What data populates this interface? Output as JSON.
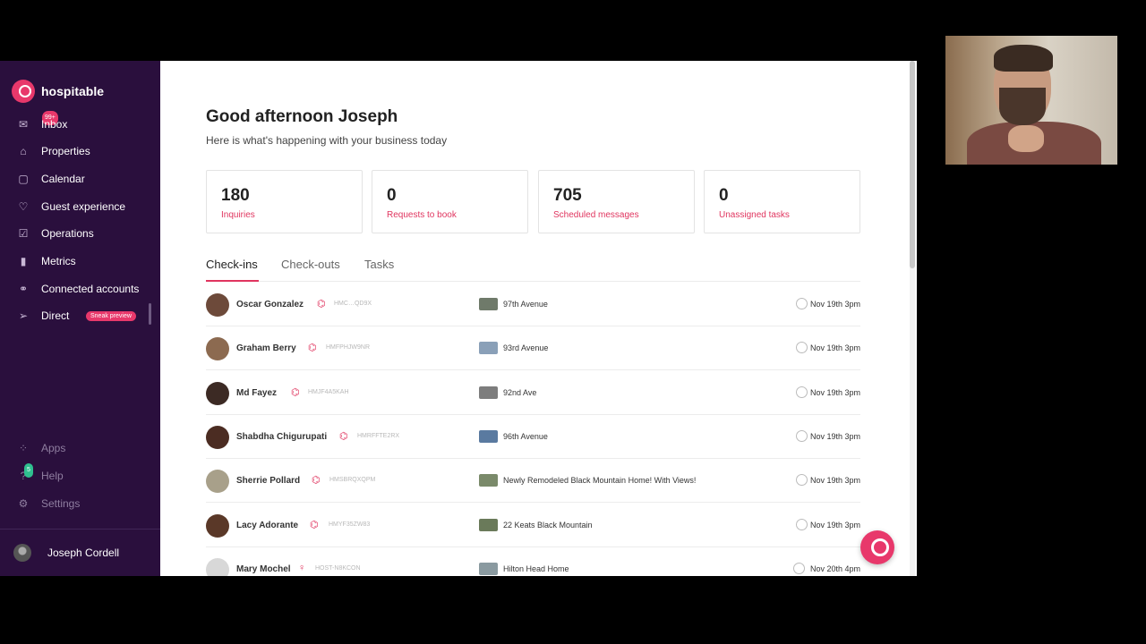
{
  "app": {
    "name": "hospitable"
  },
  "sidebar": {
    "items": [
      {
        "label": "Inbox",
        "icon": "mail-icon",
        "badge": "99+"
      },
      {
        "label": "Properties",
        "icon": "home-icon"
      },
      {
        "label": "Calendar",
        "icon": "calendar-icon"
      },
      {
        "label": "Guest experience",
        "icon": "heart-icon"
      },
      {
        "label": "Operations",
        "icon": "checkbox-icon"
      },
      {
        "label": "Metrics",
        "icon": "bar-chart-icon"
      },
      {
        "label": "Connected accounts",
        "icon": "link-icon"
      },
      {
        "label": "Direct",
        "icon": "send-icon",
        "tag": "Sneak preview"
      }
    ],
    "bottom_items": [
      {
        "label": "Apps",
        "icon": "apps-icon"
      },
      {
        "label": "Help",
        "icon": "help-icon",
        "badge": "5"
      },
      {
        "label": "Settings",
        "icon": "gear-icon"
      }
    ],
    "user": {
      "name": "Joseph Cordell"
    }
  },
  "main": {
    "greeting": "Good afternoon Joseph",
    "subtitle": "Here is what's happening with your business today",
    "stats": [
      {
        "value": "180",
        "label": "Inquiries"
      },
      {
        "value": "0",
        "label": "Requests to book"
      },
      {
        "value": "705",
        "label": "Scheduled messages"
      },
      {
        "value": "0",
        "label": "Unassigned tasks"
      }
    ],
    "tabs": [
      {
        "label": "Check-ins",
        "active": true
      },
      {
        "label": "Check-outs",
        "active": false
      },
      {
        "label": "Tasks",
        "active": false
      }
    ],
    "checkins": [
      {
        "guest": "Oscar Gonzalez",
        "channel": "airbnb-icon",
        "code": "HMC…QD9X",
        "property": "97th Avenue",
        "date": "Nov 19th 3pm"
      },
      {
        "guest": "Graham Berry",
        "channel": "airbnb-icon",
        "code": "HMFPHJW9NR",
        "property": "93rd Avenue",
        "date": "Nov 19th 3pm"
      },
      {
        "guest": "Md Fayez",
        "channel": "airbnb-icon",
        "code": "HMJF4A5KAH",
        "property": "92nd Ave",
        "date": "Nov 19th 3pm"
      },
      {
        "guest": "Shabdha Chigurupati",
        "channel": "airbnb-icon",
        "code": "HMRFFTE2RX",
        "property": "96th Avenue",
        "date": "Nov 19th 3pm"
      },
      {
        "guest": "Sherrie Pollard",
        "channel": "airbnb-icon",
        "code": "HMSBRQXQPM",
        "property": "Newly Remodeled Black Mountain Home! With Views!",
        "date": "Nov 19th 3pm"
      },
      {
        "guest": "Lacy Adorante",
        "channel": "airbnb-icon",
        "code": "HMYF35ZW83",
        "property": "22 Keats Black Mountain",
        "date": "Nov 19th 3pm"
      },
      {
        "guest": "Mary Mochel",
        "channel": "hospitable-icon",
        "code": "HOST-N8KCON",
        "property": "Hilton Head Home",
        "date": "Nov 20th 4pm"
      }
    ]
  },
  "colors": {
    "accent": "#e0355f",
    "sidebar_bg": "#2a0f3d"
  }
}
